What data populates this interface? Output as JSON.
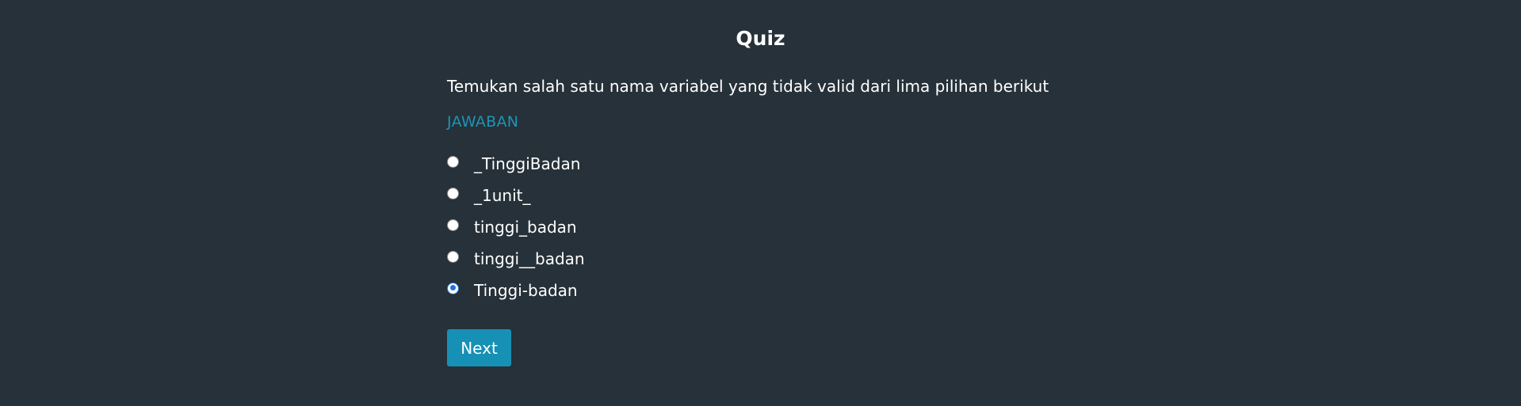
{
  "quiz": {
    "title": "Quiz",
    "question": "Temukan salah satu nama variabel yang tidak valid dari lima pilihan berikut",
    "answer_label": "JAWABAN",
    "options": [
      {
        "label": "_TinggiBadan",
        "selected": false
      },
      {
        "label": "_1unit_",
        "selected": false
      },
      {
        "label": "tinggi_badan",
        "selected": false
      },
      {
        "label": "tinggi__badan",
        "selected": false
      },
      {
        "label": "Tinggi-badan",
        "selected": true
      }
    ],
    "next_label": "Next"
  },
  "colors": {
    "background": "#263139",
    "accent": "#1690b4",
    "answer_label": "#1f93b4",
    "radio_selected": "#1a73e8",
    "text": "#ffffff"
  }
}
